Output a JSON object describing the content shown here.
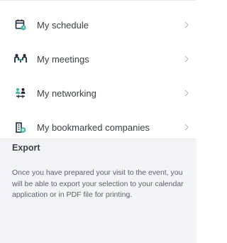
{
  "menu": {
    "items": [
      {
        "label": "My schedule",
        "icon": "calendar-icon"
      },
      {
        "label": "My meetings",
        "icon": "meeting-icon"
      },
      {
        "label": "My networking",
        "icon": "networking-icon"
      },
      {
        "label": "My bookmarked companies",
        "icon": "building-bookmark-icon"
      }
    ]
  },
  "export": {
    "title": "Export",
    "description": "Once you have prepared your visit to the event, you will be able to export your selection to your calendar application or in PDF file for printing."
  },
  "colors": {
    "icon_primary": "#1e2a3a",
    "icon_accent": "#3fb6a8",
    "text": "#3a3f4b",
    "chevron": "#b8bcc6",
    "section_bg": "#f3f4f7"
  }
}
